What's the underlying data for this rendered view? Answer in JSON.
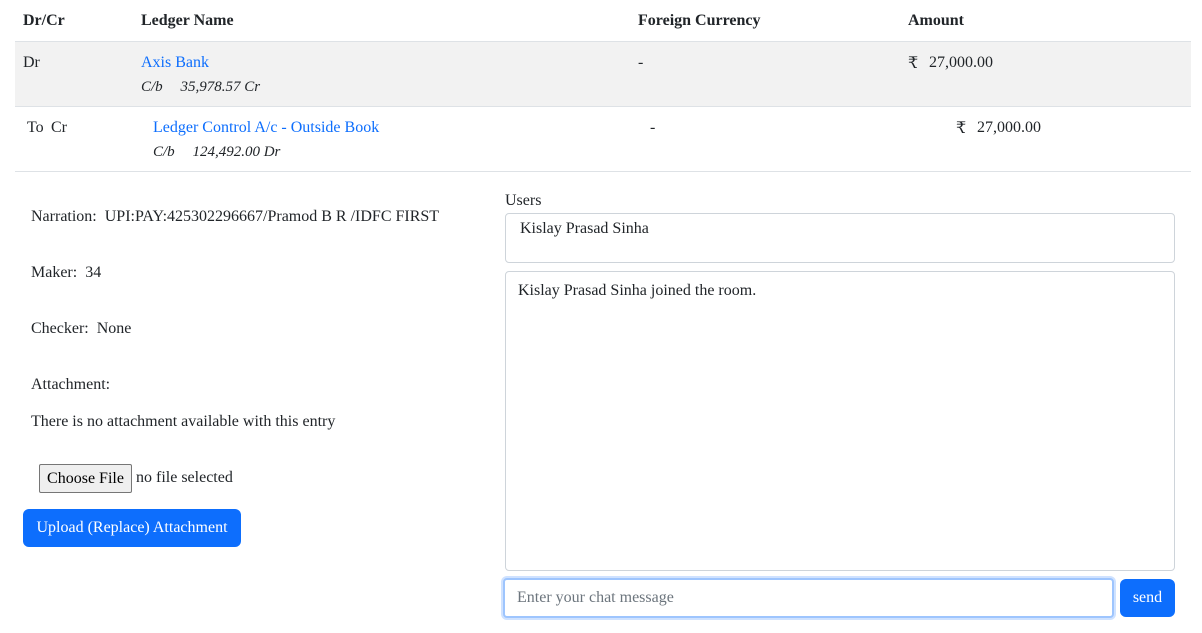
{
  "table": {
    "headers": {
      "drcr": "Dr/Cr",
      "ledger": "Ledger Name",
      "foreign": "Foreign Currency",
      "amount": "Amount"
    },
    "rows": [
      {
        "drcr": "Dr",
        "ledger": "Axis Bank",
        "cb_label": "C/b",
        "cb_value": "35,978.57 Cr",
        "foreign": "-",
        "currency_symbol": "₹",
        "amount": "27,000.00"
      },
      {
        "prefix": "To",
        "drcr": "Cr",
        "ledger": "Ledger Control A/c - Outside Book",
        "cb_label": "C/b",
        "cb_value": "124,492.00 Dr",
        "foreign": "-",
        "currency_symbol": "₹",
        "amount": "27,000.00"
      }
    ]
  },
  "details": {
    "narration_label": "Narration:",
    "narration_value": "UPI:PAY:425302296667/Pramod B R /IDFC FIRST",
    "maker_label": "Maker:",
    "maker_value": "34",
    "checker_label": "Checker:",
    "checker_value": "None",
    "attachment_label": "Attachment:",
    "attachment_status": "There is no attachment available with this entry"
  },
  "file": {
    "choose_label": "Choose File",
    "status": "no file selected",
    "upload_label": "Upload (Replace) Attachment"
  },
  "chat": {
    "users_label": "Users",
    "users": [
      "Kislay Prasad Sinha"
    ],
    "messages": [
      "Kislay Prasad Sinha joined the room."
    ],
    "input_placeholder": "Enter your chat message",
    "send_label": "send"
  },
  "colors": {
    "accent": "#0d6efd",
    "row_highlight": "#f2f2f2",
    "border": "#dee2e6"
  }
}
